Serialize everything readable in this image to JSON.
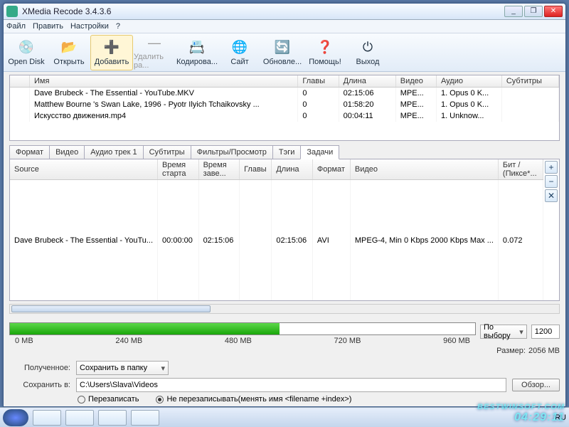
{
  "title": "XMedia Recode 3.4.3.6",
  "menu": [
    "Файл",
    "Править",
    "Настройки",
    "?"
  ],
  "toolbar": [
    {
      "label": "Open Disk",
      "icon": "💿"
    },
    {
      "label": "Открыть",
      "icon": "📂"
    },
    {
      "label": "Добавить",
      "icon": "➕",
      "active": true
    },
    {
      "label": "Удалить ра...",
      "icon": "—",
      "disabled": true
    },
    {
      "label": "Кодирова...",
      "icon": "📇"
    },
    {
      "label": "Сайт",
      "icon": "🌐"
    },
    {
      "label": "Обновле...",
      "icon": "🔄"
    },
    {
      "label": "Помощь!",
      "icon": "❓"
    },
    {
      "label": "Выход",
      "icon": "⏻"
    }
  ],
  "filecols": [
    "",
    "Имя",
    "Главы",
    "Длина",
    "Видео",
    "Аудио",
    "Субтитры"
  ],
  "files": [
    [
      "",
      "Dave Brubeck - The Essential - YouTube.MKV",
      "0",
      "02:15:06",
      "MPE...",
      "1. Opus 0 K...",
      ""
    ],
    [
      "",
      "Matthew Bourne 's Swan Lake, 1996 - Pyotr Ilyich Tchaikovsky ...",
      "0",
      "01:58:20",
      "MPE...",
      "1. Opus 0 K...",
      ""
    ],
    [
      "",
      "Искусство движения.mp4",
      "0",
      "00:04:11",
      "MPE...",
      "1. Unknow...",
      ""
    ]
  ],
  "tabs": [
    "Формат",
    "Видео",
    "Аудио трек 1",
    "Субтитры",
    "Фильтры/Просмотр",
    "Тэги",
    "Задачи"
  ],
  "activeTab": 6,
  "taskcols": [
    "Source",
    "Время старта",
    "Время заве...",
    "Главы",
    "Длина",
    "Формат",
    "Видео",
    "Бит / (Пиксе*..."
  ],
  "tasks": [
    [
      "Dave Brubeck - The Essential - YouTu...",
      "00:00:00",
      "02:15:06",
      "",
      "02:15:06",
      "AVI",
      "MPEG-4, Min 0 Kbps 2000 Kbps Max ...",
      "0.072"
    ]
  ],
  "sizeTicks": [
    "0 MB",
    "240 MB",
    "480 MB",
    "720 MB",
    "960 MB"
  ],
  "sizeSelect": "По выбору",
  "sizeValue": "1200",
  "sizeTotalLabel": "Размер:",
  "sizeTotalVal": "2056 MB",
  "dest": {
    "receivedLabel": "Полученное:",
    "receivedSelect": "Сохранить в папку",
    "saveLabel": "Сохранить в:",
    "path": "C:\\Users\\Slava\\Videos",
    "browse": "Обзор...",
    "overwrite": "Перезаписать",
    "noOverwrite": "Не перезаписывать(менять имя <filename +index>)"
  },
  "tray": "RU",
  "watermark": "BESTWINSOFT.COM",
  "watermarkTime": "04:29:11"
}
